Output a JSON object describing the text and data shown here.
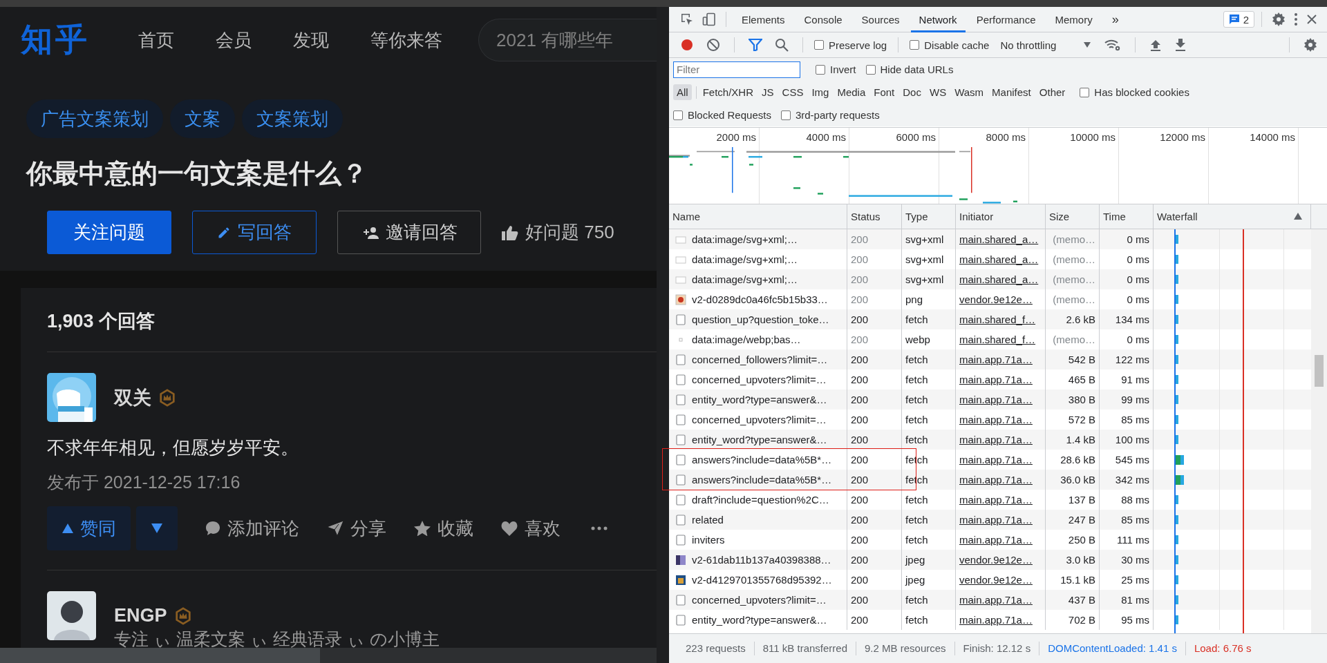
{
  "page": {
    "logo": "知乎",
    "nav": [
      "首页",
      "会员",
      "发现",
      "等你来答"
    ],
    "search": {
      "placeholder": "2021 有哪些年"
    },
    "tags": [
      "广告文案策划",
      "文案",
      "文案策划"
    ],
    "question": {
      "title": "你最中意的一句文案是什么？",
      "buttons": [
        {
          "kind": "primary",
          "label": "关注问题"
        },
        {
          "kind": "write",
          "label": "写回答"
        },
        {
          "kind": "invite",
          "label": "邀请回答"
        },
        {
          "kind": "like",
          "label": "好问题 750"
        }
      ]
    },
    "answer_count": "1,903 个回答",
    "answers": [
      {
        "author": "双关",
        "content": "不求年年相见，但愿岁岁平安。",
        "published": "发布于 2021-12-25 17:16",
        "actions": [
          {
            "kind": "upvote",
            "label": "赞同"
          },
          {
            "kind": "downvote"
          },
          {
            "kind": "comment",
            "label": "添加评论"
          },
          {
            "kind": "share",
            "label": "分享"
          },
          {
            "kind": "favorite",
            "label": "收藏"
          },
          {
            "kind": "like",
            "label": "喜欢"
          },
          {
            "kind": "more"
          }
        ]
      },
      {
        "author": "ENGP",
        "headline": "专注 ぃ 温柔文案 ぃ 经典语录 ぃ の小博主"
      }
    ]
  },
  "devtools": {
    "tabs": [
      {
        "label": "Elements",
        "selected": false
      },
      {
        "label": "Console",
        "selected": false
      },
      {
        "label": "Sources",
        "selected": false
      },
      {
        "label": "Network",
        "selected": true
      },
      {
        "label": "Performance",
        "selected": false
      },
      {
        "label": "Memory",
        "selected": false
      }
    ],
    "overflow": "»",
    "messages": "2",
    "recording": true,
    "filter_open": true,
    "toolbar_checks": [
      {
        "label": "Preserve log",
        "checked": false
      },
      {
        "label": "Disable cache",
        "checked": false
      }
    ],
    "throttling": "No throttling",
    "filter": {
      "placeholder": "Filter"
    },
    "filter_checks": [
      {
        "label": "Invert",
        "checked": false
      },
      {
        "label": "Hide data URLs",
        "checked": false
      }
    ],
    "types": [
      {
        "label": "All",
        "selected": true
      },
      {
        "label": "Fetch/XHR",
        "selected": false
      },
      {
        "label": "JS",
        "selected": false
      },
      {
        "label": "CSS",
        "selected": false
      },
      {
        "label": "Img",
        "selected": false
      },
      {
        "label": "Media",
        "selected": false
      },
      {
        "label": "Font",
        "selected": false
      },
      {
        "label": "Doc",
        "selected": false
      },
      {
        "label": "WS",
        "selected": false
      },
      {
        "label": "Wasm",
        "selected": false
      },
      {
        "label": "Manifest",
        "selected": false
      },
      {
        "label": "Other",
        "selected": false
      }
    ],
    "type_checks": [
      {
        "label": "Has blocked cookies",
        "checked": false
      }
    ],
    "more_checks": [
      {
        "label": "Blocked Requests",
        "checked": false
      },
      {
        "label": "3rd-party requests",
        "checked": false
      }
    ],
    "timeline": {
      "ticks": [
        "2000 ms",
        "4000 ms",
        "6000 ms",
        "8000 ms",
        "10000 ms",
        "12000 ms",
        "14000 ms"
      ]
    },
    "columns": [
      "Name",
      "Status",
      "Type",
      "Initiator",
      "Size",
      "Time",
      "Waterfall"
    ],
    "rows": [
      {
        "kind": "blank",
        "name": "data:image/svg+xml;…",
        "status": "200",
        "cached": true,
        "type": "svg+xml",
        "initiator": "main.shared_a…",
        "size": "(memo…",
        "time": "0 ms",
        "marked": false
      },
      {
        "kind": "blank",
        "name": "data:image/svg+xml;…",
        "status": "200",
        "cached": true,
        "type": "svg+xml",
        "initiator": "main.shared_a…",
        "size": "(memo…",
        "time": "0 ms",
        "marked": false
      },
      {
        "kind": "blank",
        "name": "data:image/svg+xml;…",
        "status": "200",
        "cached": true,
        "type": "svg+xml",
        "initiator": "main.shared_a…",
        "size": "(memo…",
        "time": "0 ms",
        "marked": false
      },
      {
        "kind": "image",
        "name": "v2-d0289dc0a46fc5b15b33…",
        "status": "200",
        "cached": true,
        "type": "png",
        "initiator": "vendor.9e12e…",
        "size": "(memo…",
        "time": "0 ms",
        "marked": false
      },
      {
        "kind": "document",
        "name": "question_up?question_toke…",
        "status": "200",
        "cached": false,
        "type": "fetch",
        "initiator": "main.shared_f…",
        "size": "2.6 kB",
        "time": "134 ms",
        "marked": false
      },
      {
        "kind": "dot",
        "name": "data:image/webp;bas…",
        "status": "200",
        "cached": true,
        "type": "webp",
        "initiator": "main.shared_f…",
        "size": "(memo…",
        "time": "0 ms",
        "marked": false
      },
      {
        "kind": "document",
        "name": "concerned_followers?limit=…",
        "status": "200",
        "cached": false,
        "type": "fetch",
        "initiator": "main.app.71a…",
        "size": "542 B",
        "time": "122 ms",
        "marked": false
      },
      {
        "kind": "document",
        "name": "concerned_upvoters?limit=…",
        "status": "200",
        "cached": false,
        "type": "fetch",
        "initiator": "main.app.71a…",
        "size": "465 B",
        "time": "91 ms",
        "marked": false
      },
      {
        "kind": "document",
        "name": "entity_word?type=answer&…",
        "status": "200",
        "cached": false,
        "type": "fetch",
        "initiator": "main.app.71a…",
        "size": "380 B",
        "time": "99 ms",
        "marked": false
      },
      {
        "kind": "document",
        "name": "concerned_upvoters?limit=…",
        "status": "200",
        "cached": false,
        "type": "fetch",
        "initiator": "main.app.71a…",
        "size": "572 B",
        "time": "85 ms",
        "marked": false
      },
      {
        "kind": "document",
        "name": "entity_word?type=answer&…",
        "status": "200",
        "cached": false,
        "type": "fetch",
        "initiator": "main.app.71a…",
        "size": "1.4 kB",
        "time": "100 ms",
        "marked": false
      },
      {
        "kind": "document",
        "name": "answers?include=data%5B*…",
        "status": "200",
        "cached": false,
        "type": "fetch",
        "initiator": "main.app.71a…",
        "size": "28.6 kB",
        "time": "545 ms",
        "marked": true
      },
      {
        "kind": "document",
        "name": "answers?include=data%5B*…",
        "status": "200",
        "cached": false,
        "type": "fetch",
        "initiator": "main.app.71a…",
        "size": "36.0 kB",
        "time": "342 ms",
        "marked": true
      },
      {
        "kind": "document",
        "name": "draft?include=question%2C…",
        "status": "200",
        "cached": false,
        "type": "fetch",
        "initiator": "main.app.71a…",
        "size": "137 B",
        "time": "88 ms",
        "marked": false
      },
      {
        "kind": "document",
        "name": "related",
        "status": "200",
        "cached": false,
        "type": "fetch",
        "initiator": "main.app.71a…",
        "size": "247 B",
        "time": "85 ms",
        "marked": false
      },
      {
        "kind": "document",
        "name": "inviters",
        "status": "200",
        "cached": false,
        "type": "fetch",
        "initiator": "main.app.71a…",
        "size": "250 B",
        "time": "111 ms",
        "marked": false
      },
      {
        "kind": "photo",
        "name": "v2-61dab11b137a40398388…",
        "status": "200",
        "cached": false,
        "type": "jpeg",
        "initiator": "vendor.9e12e…",
        "size": "3.0 kB",
        "time": "30 ms",
        "marked": false
      },
      {
        "kind": "photo-dark",
        "name": "v2-d4129701355768d95392…",
        "status": "200",
        "cached": false,
        "type": "jpeg",
        "initiator": "vendor.9e12e…",
        "size": "15.1 kB",
        "time": "25 ms",
        "marked": false
      },
      {
        "kind": "document",
        "name": "concerned_upvoters?limit=…",
        "status": "200",
        "cached": false,
        "type": "fetch",
        "initiator": "main.app.71a…",
        "size": "437 B",
        "time": "81 ms",
        "marked": false
      },
      {
        "kind": "document",
        "name": "entity_word?type=answer&…",
        "status": "200",
        "cached": false,
        "type": "fetch",
        "initiator": "main.app.71a…",
        "size": "702 B",
        "time": "95 ms",
        "marked": false
      }
    ],
    "status_bar": [
      {
        "kind": "plain",
        "text": "223 requests"
      },
      {
        "kind": "plain",
        "text": "811 kB transferred"
      },
      {
        "kind": "plain",
        "text": "9.2 MB resources"
      },
      {
        "kind": "plain",
        "text": "Finish: 12.12 s"
      },
      {
        "kind": "dom",
        "text": "DOMContentLoaded: 1.41 s"
      },
      {
        "kind": "load",
        "text": "Load: 6.76 s"
      }
    ]
  }
}
